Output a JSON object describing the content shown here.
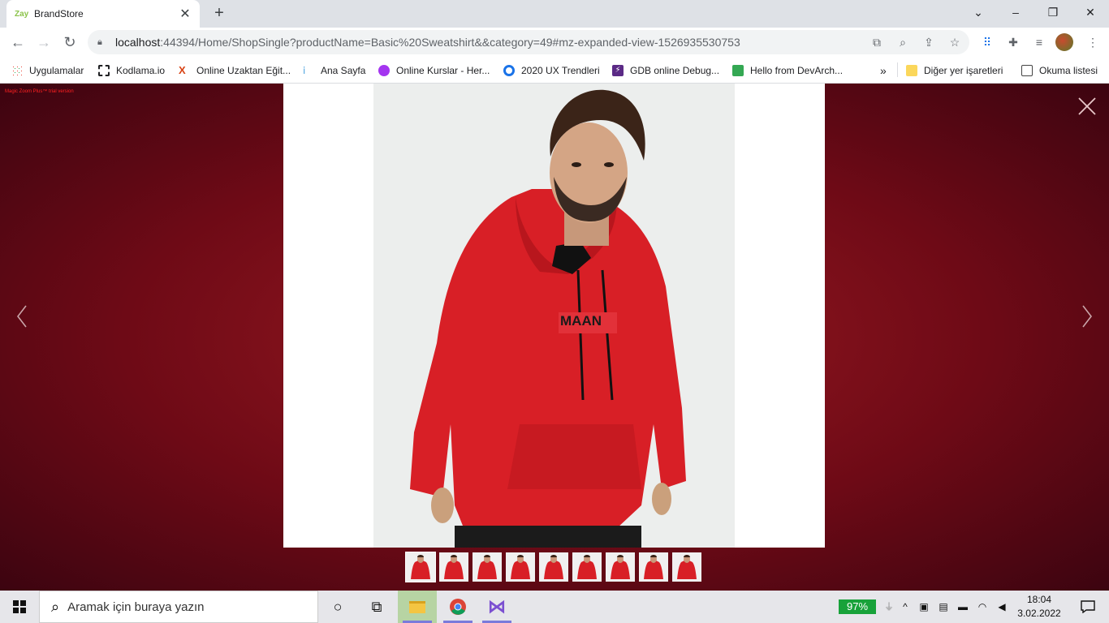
{
  "browser": {
    "tab": {
      "favicon": "Zay",
      "title": "BrandStore"
    },
    "url": {
      "host": "localhost",
      "path": ":44394/Home/ShopSingle?productName=Basic%20Sweatshirt&&category=49#mz-expanded-view-1526935530753"
    },
    "bookmarks": [
      {
        "label": "Uygulamalar",
        "icon": "apps-grid-icon",
        "color": "#ea4335"
      },
      {
        "label": "Kodlama.io",
        "icon": "kodlama-icon",
        "color": "#202124"
      },
      {
        "label": "Online Uzaktan Eğit...",
        "icon": "x-logo-icon",
        "color": "#d84315"
      },
      {
        "label": "Ana Sayfa",
        "icon": "pin-icon",
        "color": "#4aa3df"
      },
      {
        "label": "Online Kurslar - Her...",
        "icon": "udemy-icon",
        "color": "#a435f0"
      },
      {
        "label": "2020 UX Trendleri",
        "icon": "circle-logo-icon",
        "color": "#1a73e8"
      },
      {
        "label": "GDB online Debug...",
        "icon": "bolt-icon",
        "color": "#5b2a86"
      },
      {
        "label": "Hello from DevArch...",
        "icon": "devarch-icon",
        "color": "#34a853"
      }
    ],
    "bookmarks_more": "»",
    "other_bookmarks": "Diğer yer işaretleri",
    "reading_list": "Okuma listesi"
  },
  "lightbox": {
    "trial_text": "Magic Zoom Plus™ trial version",
    "product": "Basic Sweatshirt",
    "thumbnail_count": 9,
    "active_thumbnail": 0,
    "background_color": "#7a0d18"
  },
  "taskbar": {
    "search_placeholder": "Aramak için buraya yazın",
    "battery": "97%",
    "time": "18:04",
    "date": "3.02.2022"
  }
}
